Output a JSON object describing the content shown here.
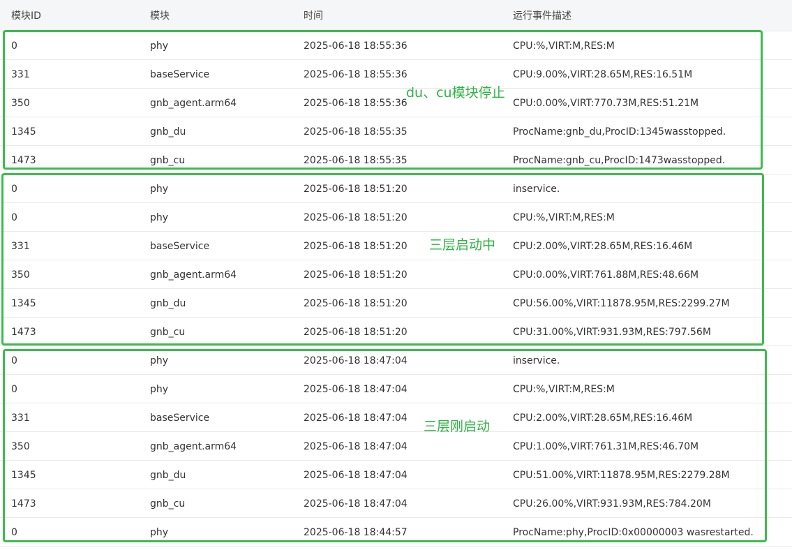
{
  "table": {
    "headers": [
      "模块ID",
      "模块",
      "时间",
      "运行事件描述"
    ],
    "rows": [
      [
        "0",
        "phy",
        "2025-06-18 18:55:36",
        "CPU:%,VIRT:M,RES:M"
      ],
      [
        "331",
        "baseService",
        "2025-06-18 18:55:36",
        "CPU:9.00%,VIRT:28.65M,RES:16.51M"
      ],
      [
        "350",
        "gnb_agent.arm64",
        "2025-06-18 18:55:36",
        "CPU:0.00%,VIRT:770.73M,RES:51.21M"
      ],
      [
        "1345",
        "gnb_du",
        "2025-06-18 18:55:35",
        "ProcName:gnb_du,ProcID:1345wasstopped."
      ],
      [
        "1473",
        "gnb_cu",
        "2025-06-18 18:55:35",
        "ProcName:gnb_cu,ProcID:1473wasstopped."
      ],
      [
        "0",
        "phy",
        "2025-06-18 18:51:20",
        "inservice."
      ],
      [
        "0",
        "phy",
        "2025-06-18 18:51:20",
        "CPU:%,VIRT:M,RES:M"
      ],
      [
        "331",
        "baseService",
        "2025-06-18 18:51:20",
        "CPU:2.00%,VIRT:28.65M,RES:16.46M"
      ],
      [
        "350",
        "gnb_agent.arm64",
        "2025-06-18 18:51:20",
        "CPU:0.00%,VIRT:761.88M,RES:48.66M"
      ],
      [
        "1345",
        "gnb_du",
        "2025-06-18 18:51:20",
        "CPU:56.00%,VIRT:11878.95M,RES:2299.27M"
      ],
      [
        "1473",
        "gnb_cu",
        "2025-06-18 18:51:20",
        "CPU:31.00%,VIRT:931.93M,RES:797.56M"
      ],
      [
        "0",
        "phy",
        "2025-06-18 18:47:04",
        "inservice."
      ],
      [
        "0",
        "phy",
        "2025-06-18 18:47:04",
        "CPU:%,VIRT:M,RES:M"
      ],
      [
        "331",
        "baseService",
        "2025-06-18 18:47:04",
        "CPU:2.00%,VIRT:28.65M,RES:16.46M"
      ],
      [
        "350",
        "gnb_agent.arm64",
        "2025-06-18 18:47:04",
        "CPU:1.00%,VIRT:761.31M,RES:46.70M"
      ],
      [
        "1345",
        "gnb_du",
        "2025-06-18 18:47:04",
        "CPU:51.00%,VIRT:11878.95M,RES:2279.28M"
      ],
      [
        "1473",
        "gnb_cu",
        "2025-06-18 18:47:04",
        "CPU:26.00%,VIRT:931.93M,RES:784.20M"
      ],
      [
        "0",
        "phy",
        "2025-06-18 18:44:57",
        "ProcName:phy,ProcID:0x00000003 wasrestarted."
      ]
    ]
  },
  "annotations": {
    "group1_label": "du、cu模块停止",
    "group2_label": "三层启动中",
    "group3_label": "三层刚启动"
  },
  "colors": {
    "annotation_green": "#3dbb4d",
    "header_bg": "#f5f6f7"
  }
}
